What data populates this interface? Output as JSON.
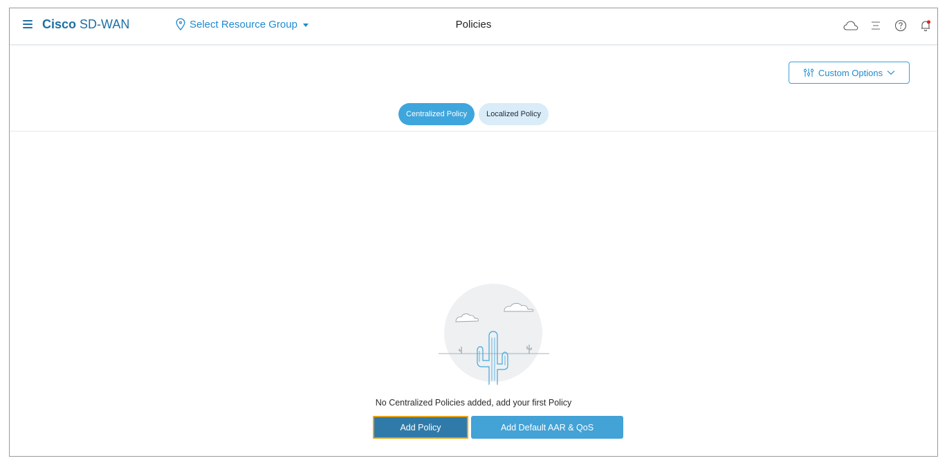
{
  "header": {
    "brand_bold": "Cisco",
    "brand_rest": "SD-WAN",
    "resource_group": "Select Resource Group",
    "title": "Policies",
    "icons": [
      "cloud-icon",
      "list-icon",
      "help-icon",
      "notification-bell-icon"
    ]
  },
  "toolbar": {
    "custom_options_label": "Custom Options"
  },
  "tabs": [
    {
      "label": "Centralized Policy",
      "active": true
    },
    {
      "label": "Localized Policy",
      "active": false
    }
  ],
  "empty_state": {
    "message": "No Centralized Policies added, add your first Policy",
    "add_policy_label": "Add Policy",
    "add_default_label": "Add Default AAR & QoS"
  },
  "colors": {
    "brand": "#1d6fa5",
    "accent": "#3ea6dc",
    "focus_outline": "#e8a317",
    "notification_dot": "#e2231a"
  }
}
